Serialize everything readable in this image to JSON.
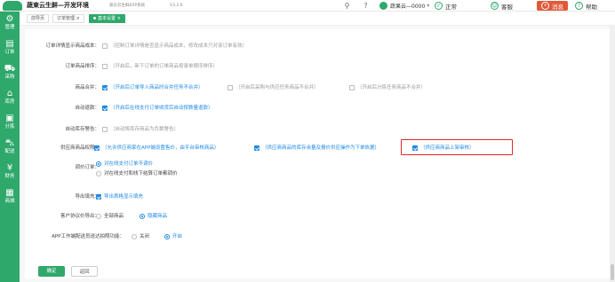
{
  "header": {
    "title": "蔬東云生鲜—开发环境",
    "subtitle": "蔬东云生鲜ERP系统",
    "version": "V3.2.6",
    "username": "蔬果云—0000",
    "status_label": "正常",
    "service_label": "客服",
    "message_label": "消息",
    "help_label": "帮助"
  },
  "sidebar": {
    "items": [
      {
        "label": "管理",
        "icon": "gear-icon"
      },
      {
        "label": "订单",
        "icon": "order-icon"
      },
      {
        "label": "采购",
        "icon": "cart-icon"
      },
      {
        "label": "库房",
        "icon": "warehouse-icon"
      },
      {
        "label": "分拣",
        "icon": "sort-icon"
      },
      {
        "label": "配送",
        "icon": "truck-icon"
      },
      {
        "label": "财务",
        "icon": "money-icon"
      },
      {
        "label": "商城",
        "icon": "grid-icon"
      }
    ]
  },
  "tabs": [
    {
      "label": "前导页"
    },
    {
      "label": "订单管理 ×"
    },
    {
      "label": "基本设置 ×"
    }
  ],
  "settings": [
    {
      "label": "订单详情显示商品成本：",
      "hint": "（控制订单详情是否显示商品成本，修改成本只对该订单有效）"
    },
    {
      "label": "订单商品排序：",
      "hint": "（开启后，新下订单的订单商品按录单顺序排序）"
    },
    {
      "label": "商品合并：",
      "opt1": "（开启后订单导入商品时合并任务不合并）",
      "opt2": "（开启后采购与供应任务商品不合并）",
      "opt3": "（开启后分拣任务商品不合并）"
    },
    {
      "label": "自动退款：",
      "hint": "（开启后在线支付订单收货后自动按数量退款）"
    },
    {
      "label": "自动库存警告：",
      "hint": "（自动将库存商品为负数警告）"
    },
    {
      "label": "供应商商品权限：",
      "opt1": "（允许供应商家在APP端设置售价，由平台审核商品）",
      "opt2": "（供应商商品的库存余量及报价供应操作为下单依据）",
      "opt3": "（供应商商品上架审核）"
    },
    {
      "label": "调价订单：",
      "opt1": "对在线支付订单不调价",
      "opt2": "对在线支付和线下结算订单都调价"
    },
    {
      "label": "导出填充：",
      "opt1": "导出表格显示填充"
    },
    {
      "label": "客户协议价导出：",
      "opt1": "全部商品",
      "opt2": "隐藏商品"
    },
    {
      "label": "APP工作端配送员送达拍照功能：",
      "opt1": "关闭",
      "opt2": "开启"
    }
  ],
  "buttons": {
    "confirm": "确定",
    "back": "返回"
  },
  "colors": {
    "brand": "#2fa86b",
    "accent": "#1e88e5",
    "highlight": "#e0282b"
  }
}
